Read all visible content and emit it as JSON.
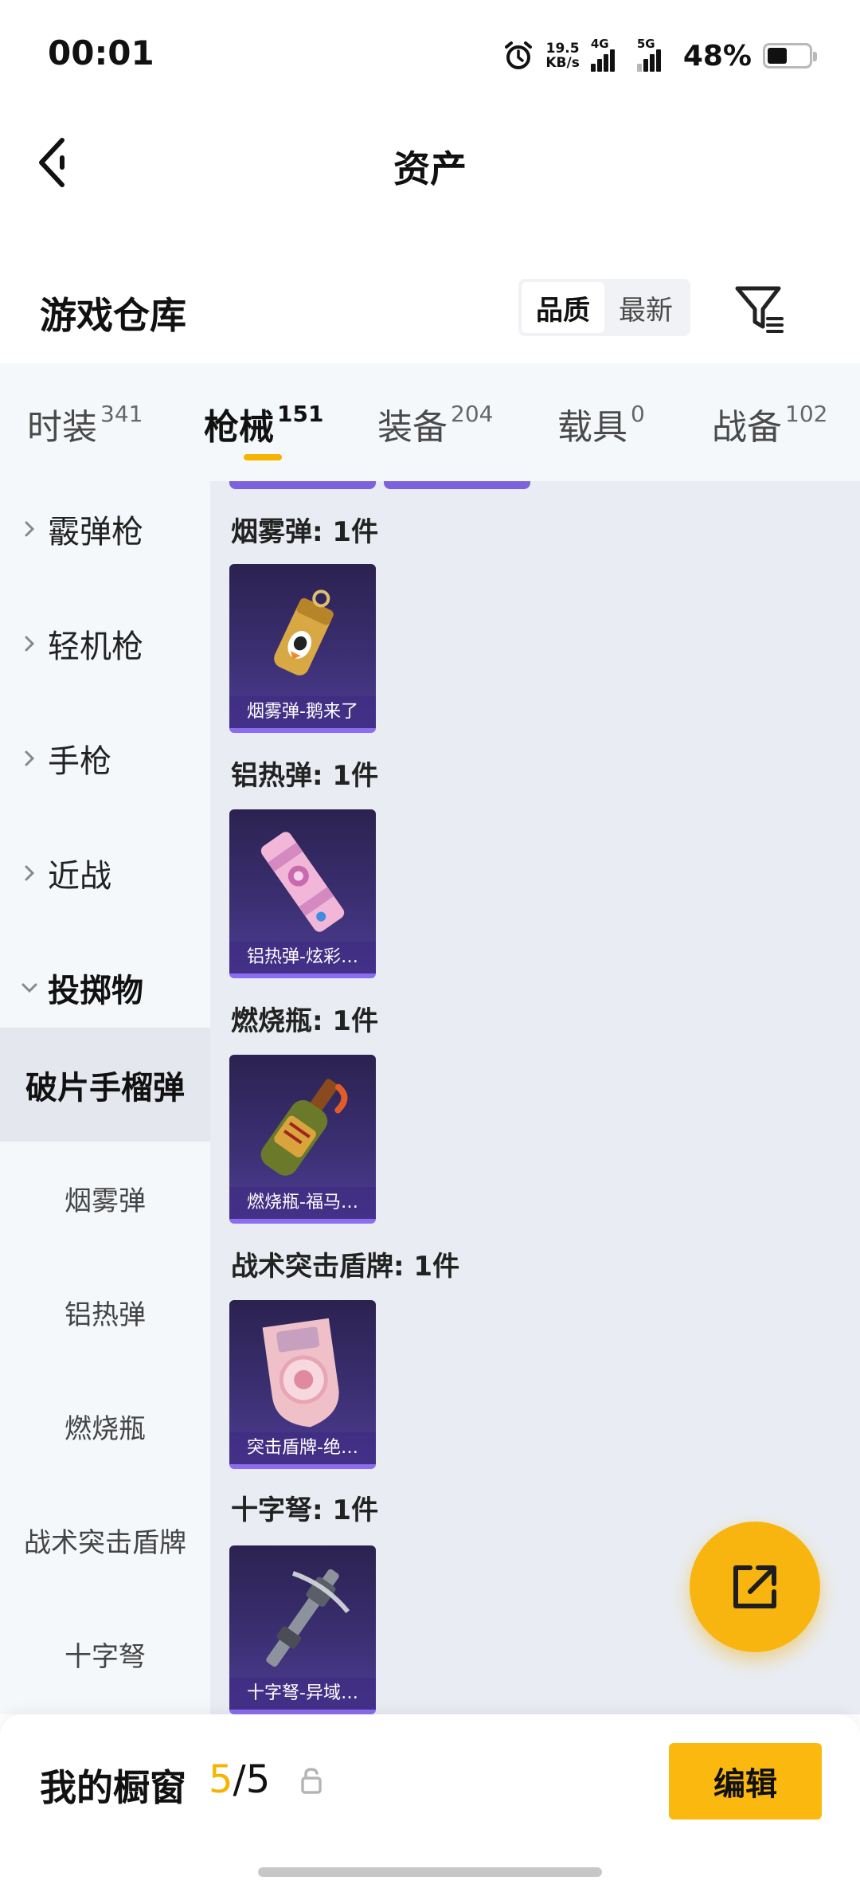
{
  "status_bar": {
    "time": "00:01",
    "net_speed_value": "19.5",
    "net_speed_unit": "KB/s",
    "sim1_label": "4G",
    "sim2_label": "5G",
    "battery_percent": "48%",
    "battery_level": 0.48,
    "icons": [
      "alarm-icon",
      "signal-icon",
      "battery-icon"
    ]
  },
  "header": {
    "title": "资产",
    "back_icon": "chevron-left-icon"
  },
  "section": {
    "title": "游戏仓库",
    "sort_options": [
      "品质",
      "最新"
    ],
    "sort_selected": "品质",
    "filter_icon": "filter-icon"
  },
  "tabs": [
    {
      "label": "时装",
      "count": "341"
    },
    {
      "label": "枪械",
      "count": "151"
    },
    {
      "label": "装备",
      "count": "204"
    },
    {
      "label": "载具",
      "count": "0"
    },
    {
      "label": "战备",
      "count": "102"
    }
  ],
  "active_tab": "枪械",
  "sidebar": {
    "categories": [
      "霰弹枪",
      "轻机枪",
      "手枪",
      "近战",
      "投掷物"
    ],
    "expanded_category": "投掷物",
    "sub_items": [
      "破片手榴弹",
      "烟雾弹",
      "铝热弹",
      "燃烧瓶",
      "战术突击盾牌",
      "十字弩"
    ],
    "active_sub_item": "破片手榴弹"
  },
  "groups": [
    {
      "title": "烟雾弹: 1件",
      "item_name": "烟雾弹-鹅来了",
      "icon": "smoke-grenade-icon"
    },
    {
      "title": "铝热弹: 1件",
      "item_name": "铝热弹-炫彩…",
      "icon": "thermite-icon"
    },
    {
      "title": "燃烧瓶: 1件",
      "item_name": "燃烧瓶-福马…",
      "icon": "molotov-icon"
    },
    {
      "title": "战术突击盾牌: 1件",
      "item_name": "突击盾牌-绝…",
      "icon": "shield-icon"
    },
    {
      "title": "十字弩: 1件",
      "item_name": "十字弩-异域…",
      "icon": "crossbow-icon"
    }
  ],
  "fab": {
    "icon": "share-icon"
  },
  "bottom_bar": {
    "label": "我的橱窗",
    "count_current": "5",
    "count_separator": "/",
    "count_total": "5",
    "lock_icon": "lock-icon",
    "edit_label": "编辑"
  },
  "colors": {
    "accent": "#f5b400",
    "card_bg": "#3b2f72",
    "card_border": "#8c6cf0",
    "content_bg": "#e9edf3",
    "sidebar_bg": "#f5f8fb"
  }
}
